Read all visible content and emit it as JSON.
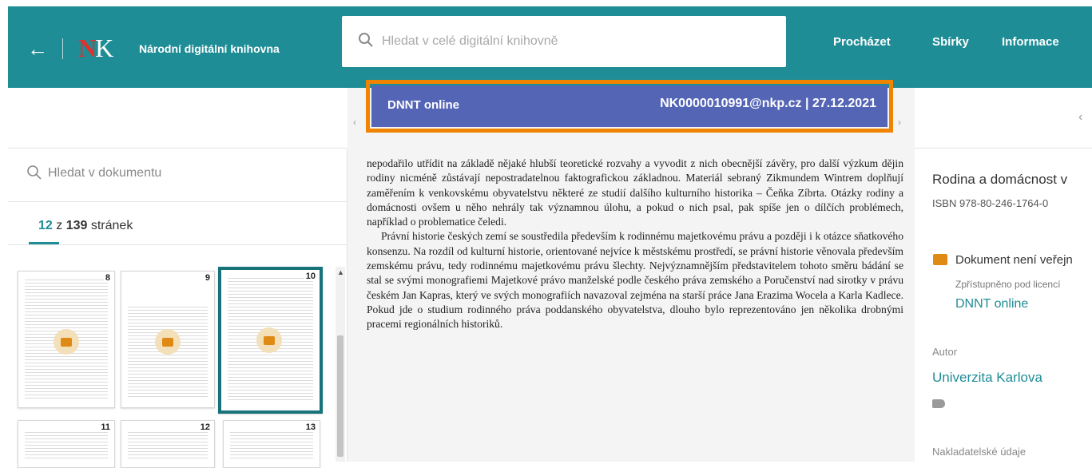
{
  "header": {
    "back_icon": "arrow-left-icon",
    "logo_n": "N",
    "logo_k": "K",
    "app_name": "Národní digitální knihovna",
    "search_placeholder": "Hledat v celé digitální knihovně",
    "nav": [
      "Procházet",
      "Sbírky",
      "Informace"
    ],
    "brand_color": "#1e8d96"
  },
  "licence_banner": {
    "label": "DNNT online",
    "user_date": "NK0000010991@nkp.cz | 27.12.2021",
    "banner_color": "#5565b6",
    "highlight_color": "#f08400"
  },
  "left_panel": {
    "doc_search_placeholder": "Hledat v dokumentu",
    "pages": {
      "current": "12",
      "separator": "z",
      "total": "139",
      "unit": "stránek"
    },
    "thumbnails": [
      {
        "page": "8",
        "locked": true,
        "active": false
      },
      {
        "page": "9",
        "locked": true,
        "active": false
      },
      {
        "page": "10",
        "locked": true,
        "active": true
      },
      {
        "page": "11",
        "locked": false,
        "active": false
      },
      {
        "page": "12",
        "locked": false,
        "active": false
      },
      {
        "page": "13",
        "locked": false,
        "active": false
      }
    ]
  },
  "page_text": {
    "p1": "nepodařilo utřídit na základě nějaké hlubší teoretické rozvahy a vyvodit z nich obecnější závěry, pro další výzkum dějin rodiny nicméně zůstávají nepostradatelnou faktografickou základnou. Materiál sebraný Zikmundem Wintrem doplňují zaměřením k venkovskému obyvatelstvu některé ze studií dalšího kulturního historika – Čeňka Zíbrta. Otázky rodiny a domácnosti ovšem u něho nehrály tak významnou úlohu, a pokud o nich psal, pak spíše jen o dílčích problémech, například o problematice čeledi.",
    "p2": "Právní historie českých zemí se soustředila především k rodinnému majetkovému právu a později i k otázce sňatkového konsenzu. Na rozdíl od kulturní historie, orientované nejvíce k městskému prostředí, se právní historie věnovala především zemskému právu, tedy rodinnému majetkovému právu šlechty. Nejvýznamnějším představitelem tohoto směru bádání se stal se svými monografiemi Majetkové právo manželské podle českého práva zemského a Poručenství nad sirotky v právu českém Jan Kapras, který ve svých monografiích navazoval zejména na starší práce Jana Erazima Wocela a Karla Kadlece. Pokud jde o studium rodinného práva poddanského obyvatelstva, dlouho bylo reprezentováno jen několika drobnými pracemi regionálních historiků."
  },
  "right_panel": {
    "title": "Rodina a domácnost v",
    "isbn": "ISBN 978-80-246-1764-0",
    "notice": "Dokument není veřejn",
    "licence_label": "Zpřístupněno pod licencí",
    "licence": "DNNT online",
    "author_label": "Autor",
    "author": "Univerzita Karlova",
    "publisher_label": "Nakladatelské údaje"
  }
}
